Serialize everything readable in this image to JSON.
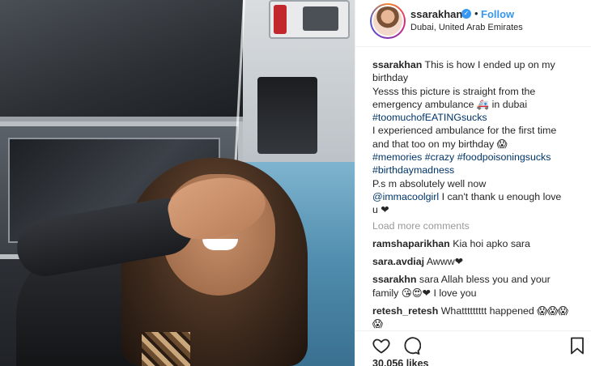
{
  "post": {
    "username": "ssarakhan",
    "verified_glyph": "✓",
    "separator": "•",
    "follow_label": "Follow",
    "location": "Dubai, United Arab Emirates"
  },
  "caption": {
    "line1": "This is how I ended up on my",
    "line2": "birthday",
    "line3": "Yesss this picture is straight from the",
    "line4": "emergency ambulance 🚑 in dubai",
    "tag1": "#toomuchofEATINGsucks",
    "line5": "I experienced ambulance for the first time",
    "line6": "and that too on my birthday 😱",
    "tag2": "#memories",
    "tag3": "#crazy",
    "tag4": "#foodpoisoningsucks",
    "tag5": "#birthdaymadness",
    "line7": "P.s m absolutely well now",
    "mention": "@immacoolgirl",
    "line8": "I can't thank u enough love",
    "line9": "u ❤"
  },
  "load_more": "Load more comments",
  "comments": [
    {
      "user": "ramshaparikhan",
      "text": "Kia hoi apko sara",
      "cont": ""
    },
    {
      "user": "sara.avdiaj",
      "text": "Awww❤",
      "cont": ""
    },
    {
      "user": "ssarakhn",
      "text": "sara Allah bless you and your",
      "cont": "family 😘😍❤ I love you"
    },
    {
      "user": "retesh_retesh",
      "text": "Whattttttttt happened 😱😱😱",
      "cont": "😱"
    }
  ],
  "actions": {
    "like_icon": "heart-icon",
    "comment_icon": "comment-icon",
    "save_icon": "bookmark-icon"
  },
  "likes": "30,056 likes",
  "colors": {
    "link": "#003569",
    "follow": "#3897f0",
    "muted": "#999999"
  }
}
